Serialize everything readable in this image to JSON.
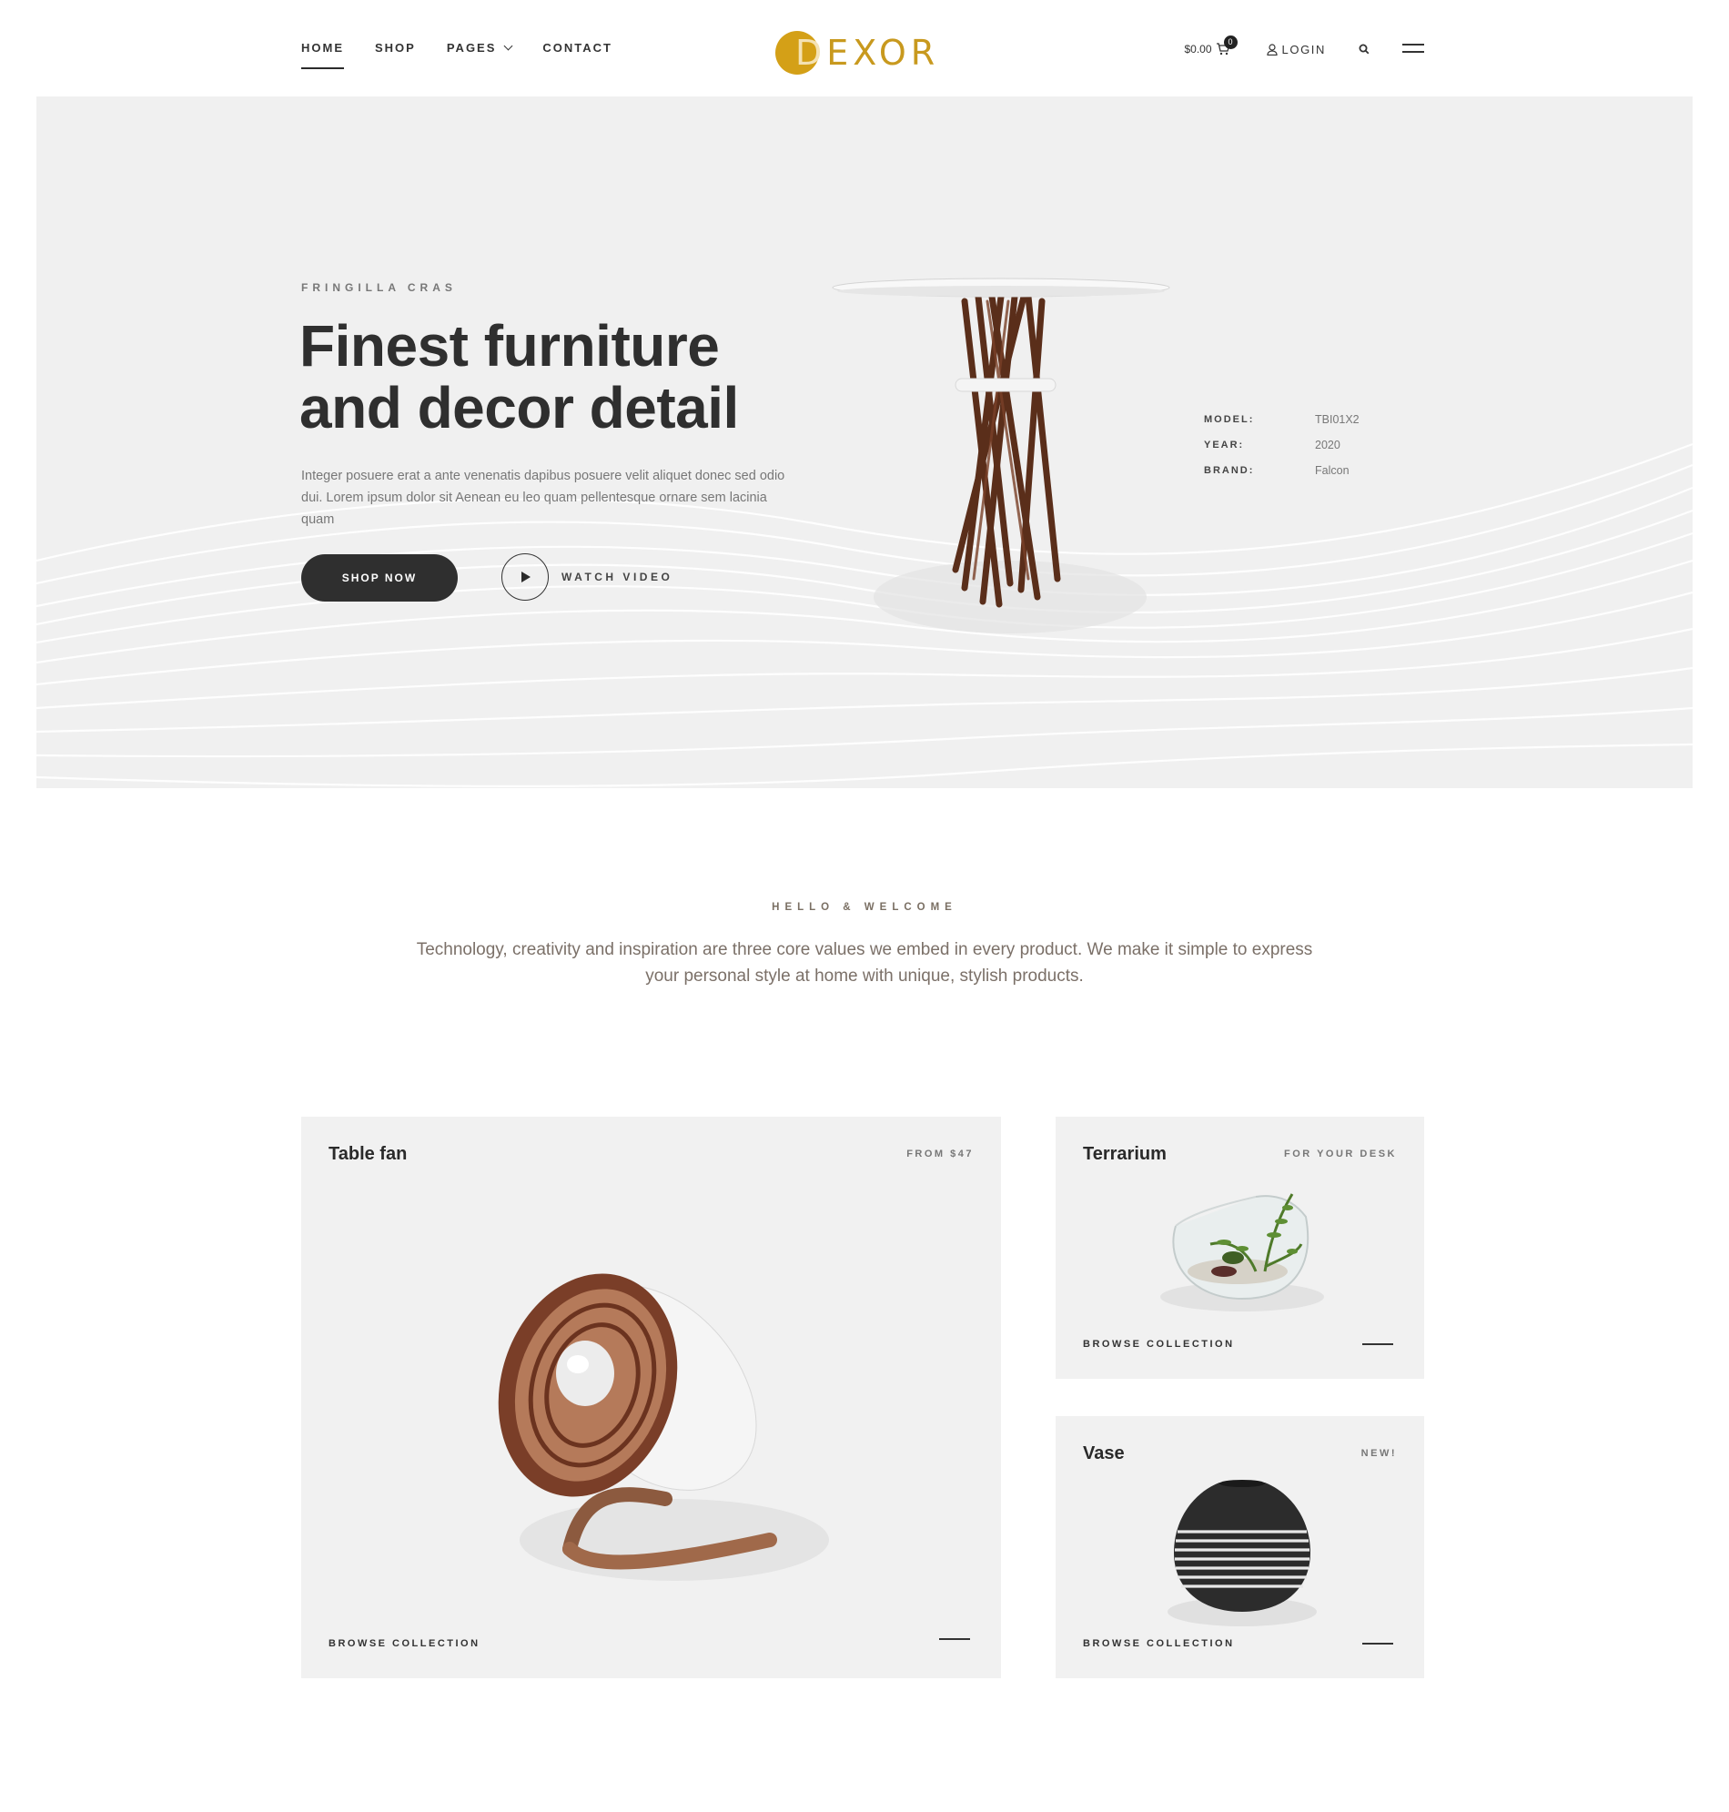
{
  "header": {
    "nav": [
      {
        "label": "HOME",
        "active": true
      },
      {
        "label": "SHOP",
        "active": false
      },
      {
        "label": "PAGES",
        "active": false,
        "has_dropdown": true
      },
      {
        "label": "CONTACT",
        "active": false
      }
    ],
    "logo": {
      "text_first": "D",
      "text_rest": "EXOR",
      "color": "#d4a017"
    },
    "cart": {
      "total": "$0.00",
      "count": "0",
      "icon": "cart-icon"
    },
    "login_label": "LOGIN",
    "search_icon": "search-icon",
    "menu_icon": "hamburger-icon"
  },
  "hero": {
    "eyebrow": "FRINGILLA CRAS",
    "title_line1": "Finest furniture",
    "title_line2": "and decor detail",
    "text": "Integer posuere erat a ante venenatis dapibus posuere velit aliquet donec sed odio dui. Lorem ipsum dolor sit Aenean eu leo quam pellentesque ornare sem lacinia quam",
    "shop_now_label": "SHOP NOW",
    "watch_video_label": "WATCH VIDEO",
    "specs": [
      {
        "label": "MODEL:",
        "value": "TBI01X2"
      },
      {
        "label": "YEAR:",
        "value": "2020"
      },
      {
        "label": "BRAND:",
        "value": "Falcon"
      }
    ]
  },
  "welcome": {
    "eyebrow": "HELLO & WELCOME",
    "text": "Technology, creativity and inspiration are three core values we embed in every product. We make it simple to express your personal style at home with unique, stylish products."
  },
  "products": [
    {
      "title": "Table fan",
      "tag": "FROM $47",
      "browse": "BROWSE COLLECTION"
    },
    {
      "title": "Terrarium",
      "tag": "FOR YOUR DESK",
      "browse": "BROWSE COLLECTION"
    },
    {
      "title": "Vase",
      "tag": "NEW!",
      "browse": "BROWSE COLLECTION"
    }
  ],
  "colors": {
    "accent": "#d4a017",
    "dark": "#2f2f2f",
    "hero_bg": "#f0f0f0",
    "card_bg": "#f1f1f1"
  }
}
